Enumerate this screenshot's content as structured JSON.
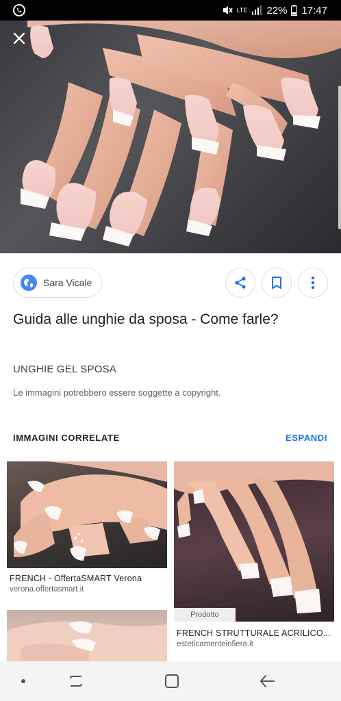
{
  "status_bar": {
    "battery": "22%",
    "time": "17:47",
    "network": "LTE"
  },
  "viewer": {
    "close_icon": "close-icon"
  },
  "source": {
    "name": "Sara Vicale",
    "icon": "globe-icon",
    "accent": "#4285f4"
  },
  "actions": {
    "share_icon": "share-icon",
    "bookmark_icon": "bookmark-icon",
    "more_icon": "more-vert-icon",
    "icon_color": "#1a73e8"
  },
  "details": {
    "title": "Guida alle unghie da sposa - Come farle?",
    "subtitle": "UNGHIE GEL SPOSA",
    "copyright": "Le immagini potrebbero essere soggette a copyright."
  },
  "related": {
    "heading": "IMMAGINI CORRELATE",
    "expand_label": "ESPANDI",
    "items": [
      {
        "title": "FRENCH - OffertaSMART Verona",
        "domain": "verona.offertasmart.it",
        "badge": ""
      },
      {
        "title": "FRENCH STRUTTURALE ACRILICO...",
        "domain": "esteticamenteinfiera.it",
        "badge": "Prodotto"
      },
      {
        "title": "",
        "domain": "",
        "badge": ""
      }
    ]
  },
  "nav_bar": {
    "items": [
      "dot-icon",
      "recents-icon",
      "home-icon",
      "back-icon"
    ]
  }
}
